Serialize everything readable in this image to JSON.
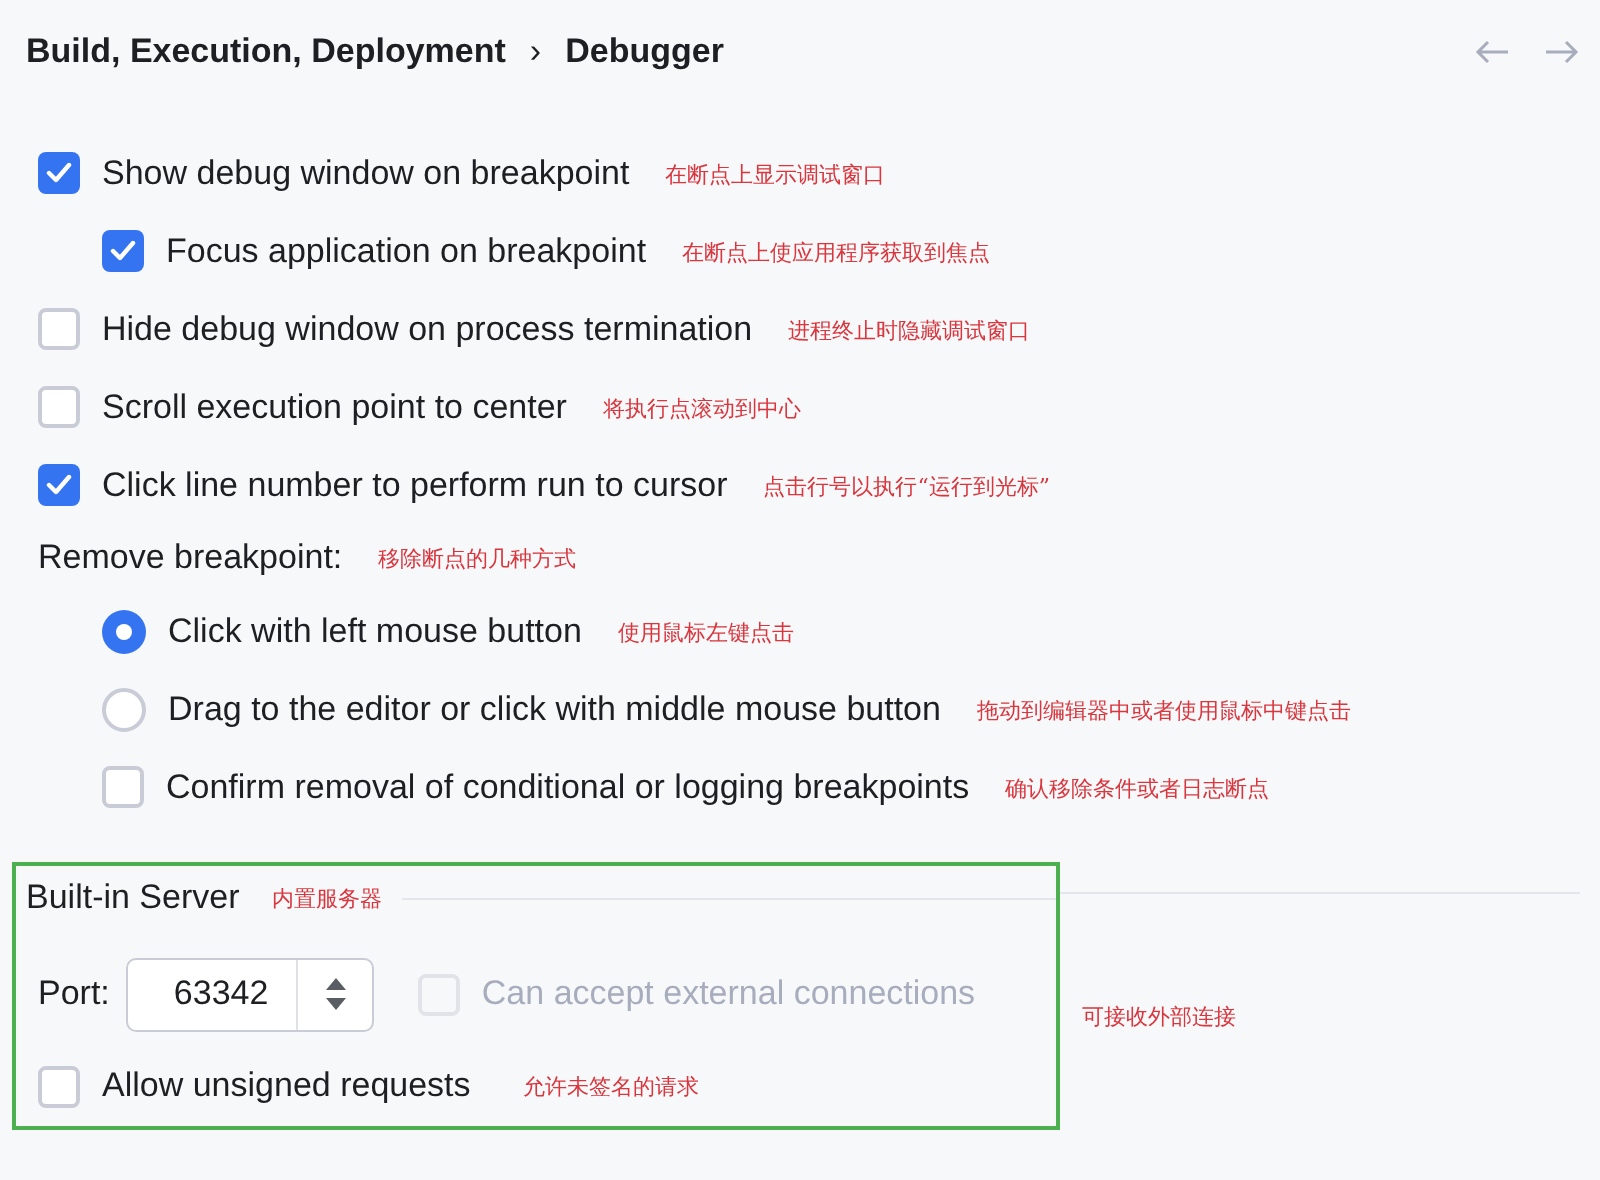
{
  "breadcrumb": {
    "parent": "Build, Execution, Deployment",
    "separator": "›",
    "current": "Debugger"
  },
  "options": [
    {
      "kind": "checkbox",
      "label": "Show debug window on breakpoint",
      "checked": true,
      "note": "在断点上显示调试窗口",
      "children": [
        {
          "kind": "checkbox",
          "label": "Focus application on breakpoint",
          "checked": true,
          "note": "在断点上使应用程序获取到焦点"
        }
      ]
    },
    {
      "kind": "checkbox",
      "label": "Hide debug window on process termination",
      "checked": false,
      "note": "进程终止时隐藏调试窗口"
    },
    {
      "kind": "checkbox",
      "label": "Scroll execution point to center",
      "checked": false,
      "note": "将执行点滚动到中心"
    },
    {
      "kind": "checkbox",
      "label": "Click line number to perform run to cursor",
      "checked": true,
      "note": "点击行号以执行“运行到光标”"
    },
    {
      "kind": "label",
      "label": "Remove breakpoint:",
      "note": "移除断点的几种方式",
      "children": [
        {
          "kind": "radio",
          "label": "Click with left mouse button",
          "selected": true,
          "note": "使用鼠标左键点击"
        },
        {
          "kind": "radio",
          "label": "Drag to the editor or click with middle mouse button",
          "selected": false,
          "note": "拖动到编辑器中或者使用鼠标中键点击"
        },
        {
          "kind": "checkbox",
          "label": "Confirm removal of conditional or logging breakpoints",
          "checked": false,
          "note": "确认移除条件或者日志断点"
        }
      ]
    }
  ],
  "server": {
    "title": "Built-in Server",
    "note": "内置服务器",
    "highlighted": true,
    "port": {
      "label": "Port:",
      "value": "63342"
    },
    "external": {
      "label": "Can accept external connections",
      "checked": false,
      "disabled": true,
      "note": "可接收外部连接"
    },
    "unsigned": {
      "label": "Allow unsigned requests",
      "checked": false,
      "note": "允许未签名的请求"
    }
  }
}
